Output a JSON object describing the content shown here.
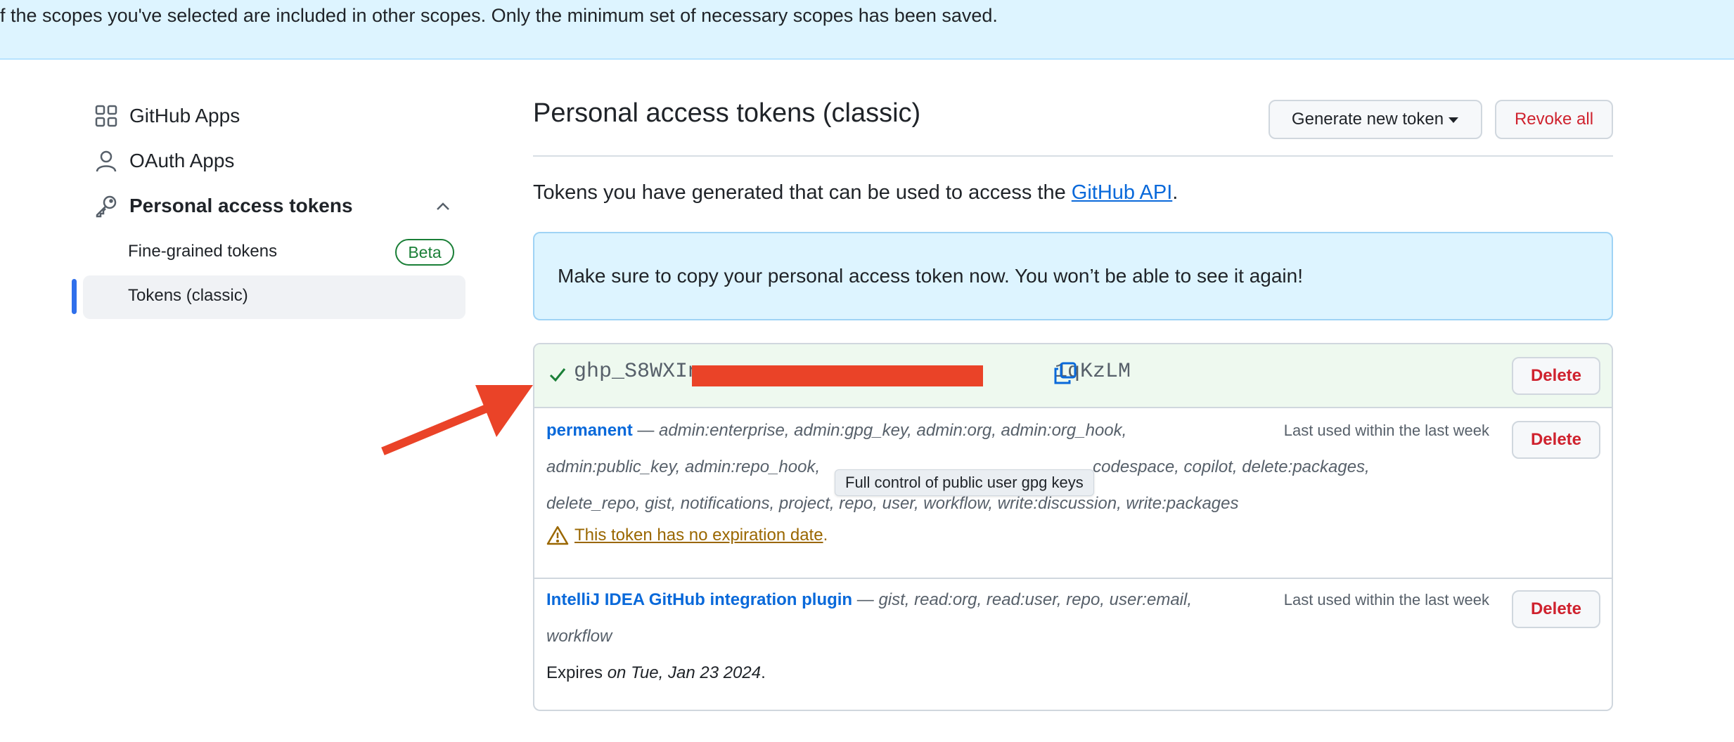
{
  "top_flash": {
    "text": "f the scopes you've selected are included in other scopes. Only the minimum set of necessary scopes has been saved."
  },
  "sidebar": {
    "items": [
      {
        "label": "GitHub Apps",
        "icon": "apps-grid-icon"
      },
      {
        "label": "OAuth Apps",
        "icon": "person-icon"
      },
      {
        "label": "Personal access tokens",
        "icon": "key-icon"
      }
    ],
    "sub_items": [
      {
        "label": "Fine-grained tokens",
        "badge": "Beta"
      },
      {
        "label": "Tokens (classic)",
        "selected": true
      }
    ]
  },
  "main": {
    "title": "Personal access tokens (classic)",
    "generate_button": "Generate new token",
    "revoke_button": "Revoke all",
    "intro_text": "Tokens you have generated that can be used to access the ",
    "intro_link": "GitHub API",
    "intro_end": ".",
    "notice": "Make sure to copy your personal access token now. You won’t be able to see it again!",
    "new_token": {
      "prefix": "ghp_S8WXIn",
      "suffix": "1qKzLM",
      "delete": "Delete"
    },
    "tokens": [
      {
        "name": "permanent",
        "dash": " — ",
        "scopes_line1": "admin:enterprise, admin:gpg_key, admin:org, admin:org_hook,",
        "scopes_line2_start": "admin:public_key, admin:repo_hook,",
        "scopes_line2_end": "codespace, copilot, delete:packages,",
        "scopes_line3": "delete_repo, gist, notifications, project, repo, user, workflow, write:discussion, write:packages",
        "last_used": "Last used within the last week",
        "warning": "This token has no expiration date",
        "warning_end": ".",
        "delete": "Delete"
      },
      {
        "name": "IntelliJ IDEA GitHub integration plugin",
        "dash": " — ",
        "scopes_line1": "gist, read:org, read:user, repo, user:email,",
        "scopes_line2": "workflow",
        "last_used": "Last used within the last week",
        "expires_label": "Expires ",
        "expires_date": "on Tue, Jan 23 2024",
        "expires_end": ".",
        "delete": "Delete"
      }
    ],
    "tooltip": "Full control of public user gpg keys"
  },
  "colors": {
    "accent": "#0969da",
    "danger": "#cf222e",
    "success": "#1a7f37",
    "warning": "#9a6700",
    "annotation_arrow": "#ea4328"
  }
}
